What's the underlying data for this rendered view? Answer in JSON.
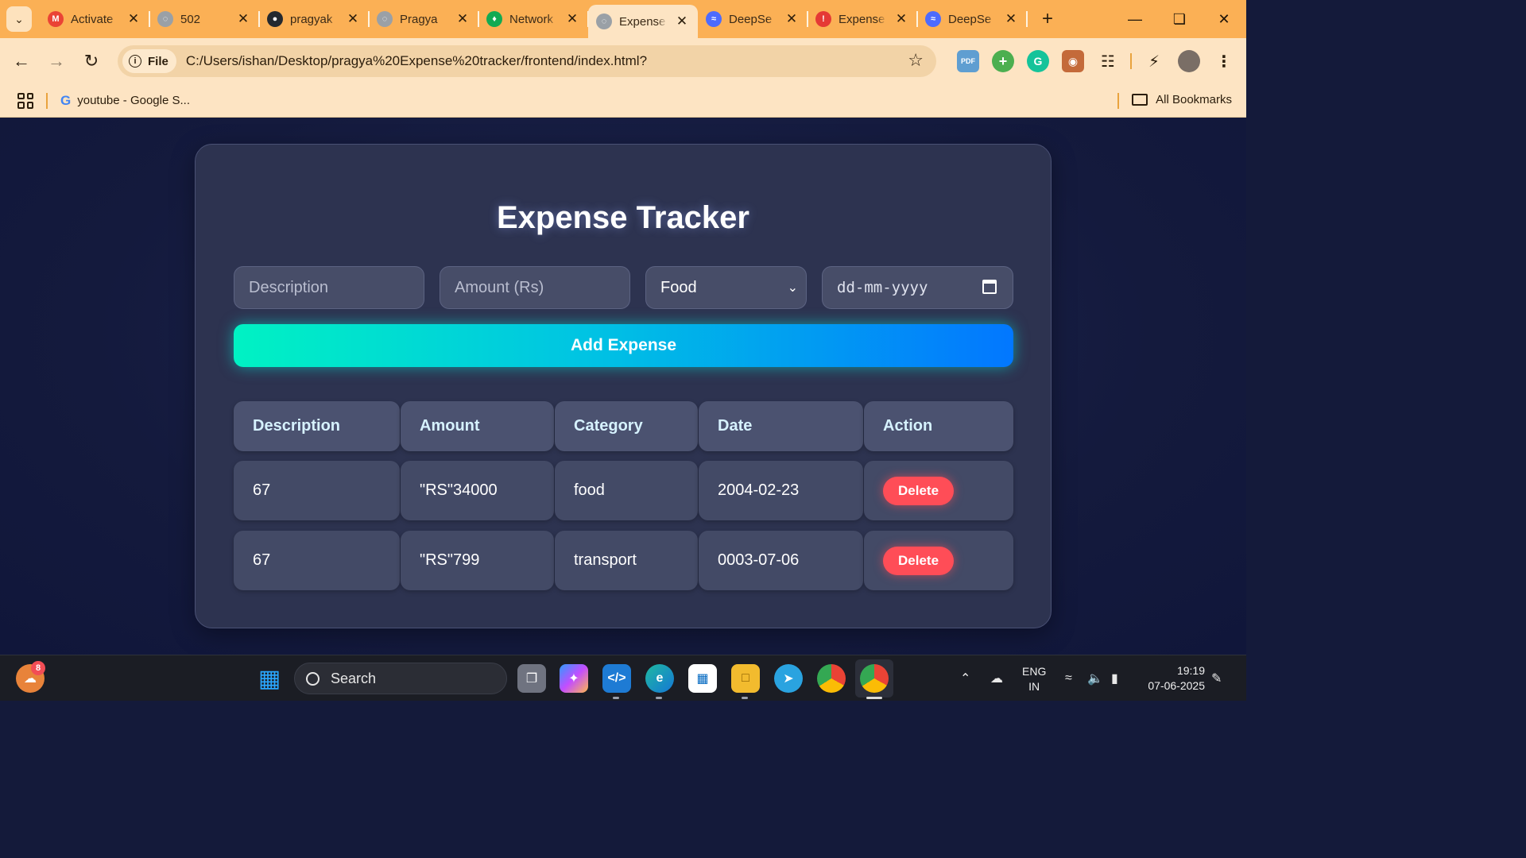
{
  "browser": {
    "tabs": [
      {
        "title": "Activate",
        "favicon": "gmail-icon",
        "color": "#ea4335"
      },
      {
        "title": "502",
        "favicon": "globe-icon",
        "color": "#9aa0a6"
      },
      {
        "title": "pragyak",
        "favicon": "github-icon",
        "color": "#24292f"
      },
      {
        "title": "Pragya",
        "favicon": "globe-icon",
        "color": "#9aa0a6"
      },
      {
        "title": "Network",
        "favicon": "mongodb-leaf-icon",
        "color": "#13aa52"
      },
      {
        "title": "Expense",
        "favicon": "globe-icon",
        "color": "#9aa0a6",
        "active": true
      },
      {
        "title": "DeepSe",
        "favicon": "deepseek-icon",
        "color": "#4d6bfe"
      },
      {
        "title": "Expense",
        "favicon": "error-page-icon",
        "color": "#e53935"
      },
      {
        "title": "DeepSe",
        "favicon": "deepseek-icon",
        "color": "#4d6bfe"
      }
    ],
    "address": {
      "scheme_chip": "File",
      "url": "C:/Users/ishan/Desktop/pragya%20Expense%20tracker/frontend/index.html?"
    },
    "extensions": [
      {
        "name": "pdf-extension-icon",
        "label": "PDF",
        "color": "#5f9ed1"
      },
      {
        "name": "add-extension-icon",
        "label": "+",
        "color": "#4caf50"
      },
      {
        "name": "grammarly-icon",
        "label": "G",
        "color": "#15c39a"
      },
      {
        "name": "owl-extension-icon",
        "label": "◉",
        "color": "#c46a3a"
      }
    ],
    "bookmarks": {
      "items": [
        {
          "label": "youtube - Google S..."
        }
      ],
      "all_label": "All Bookmarks"
    }
  },
  "app": {
    "title": "Expense Tracker",
    "form": {
      "description_placeholder": "Description",
      "amount_placeholder": "Amount (Rs)",
      "category_value": "Food",
      "date_placeholder": "dd-mm-yyyy",
      "submit_label": "Add Expense"
    },
    "table": {
      "headers": [
        "Description",
        "Amount",
        "Category",
        "Date",
        "Action"
      ],
      "rows": [
        {
          "description": "67",
          "amount": "\"RS\"34000",
          "category": "food",
          "date": "2004-02-23",
          "action": "Delete"
        },
        {
          "description": "67",
          "amount": "\"RS\"799",
          "category": "transport",
          "date": "0003-07-06",
          "action": "Delete"
        }
      ]
    }
  },
  "taskbar": {
    "search_label": "Search",
    "notification_badge": "8",
    "language": {
      "line1": "ENG",
      "line2": "IN"
    },
    "clock": {
      "time": "19:19",
      "date": "07-06-2025"
    }
  }
}
